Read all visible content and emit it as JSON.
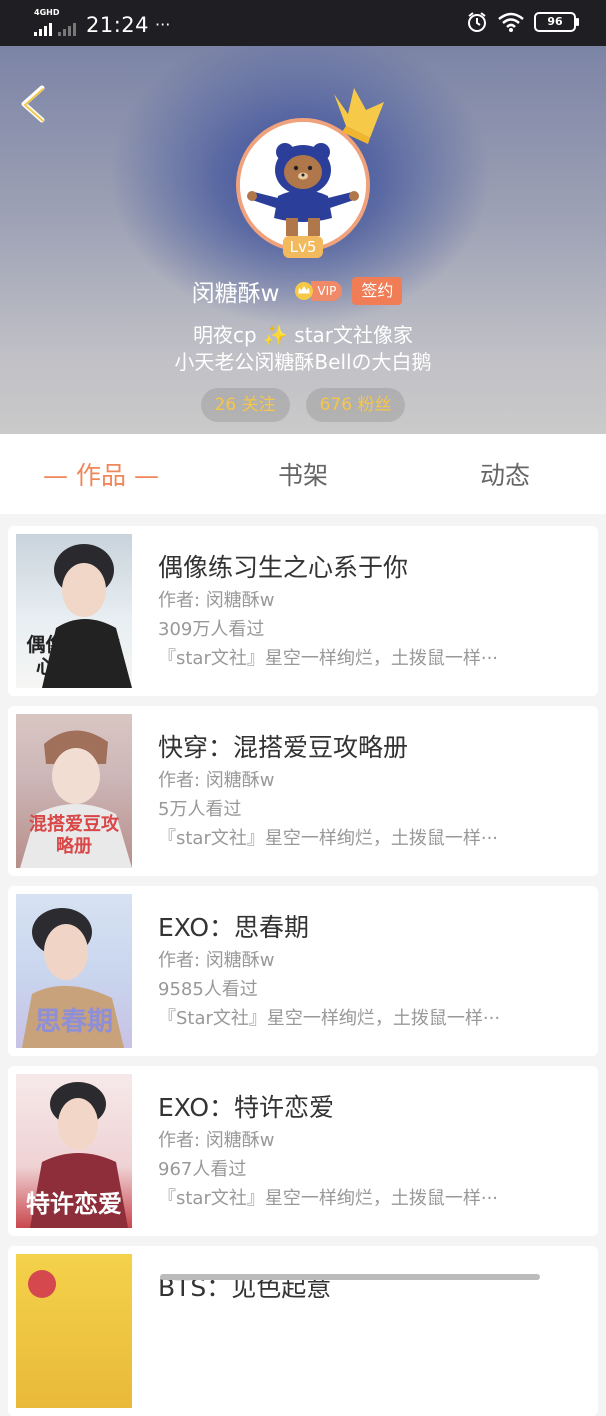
{
  "status_bar": {
    "network": "4GHD",
    "time": "21:24",
    "dots": "···",
    "battery": "96"
  },
  "profile": {
    "level": "Lv5",
    "username": "闵糖酥w",
    "vip_label": "VIP",
    "signed_label": "签约",
    "bio_line1": "明夜cp ✨ star文社像家",
    "bio_line2": "小天老公闵糖酥Bellの大白鹅",
    "following": "26 关注",
    "followers": "676 粉丝"
  },
  "tabs": [
    {
      "label": "— 作品 —",
      "active": true
    },
    {
      "label": "书架",
      "active": false
    },
    {
      "label": "动态",
      "active": false
    }
  ],
  "books": [
    {
      "title": "偶像练习生之心系于你",
      "author": "作者: 闵糖酥w",
      "views": "309万人看过",
      "desc": "『star文社』星空一样绚烂，土拨鼠一样···"
    },
    {
      "title": "快穿：混搭爱豆攻略册",
      "author": "作者: 闵糖酥w",
      "views": "5万人看过",
      "desc": "『star文社』星空一样绚烂，土拨鼠一样···"
    },
    {
      "title": "EXO：思春期",
      "author": "作者: 闵糖酥w",
      "views": "9585人看过",
      "desc": "『Star文社』星空一样绚烂，土拨鼠一样···"
    },
    {
      "title": "EXO：特许恋爱",
      "author": "作者: 闵糖酥w",
      "views": "967人看过",
      "desc": "『star文社』星空一样绚烂，土拨鼠一样···"
    },
    {
      "title": "BTS：见色起意"
    }
  ],
  "covers": [
    {
      "text": "偶像练习之心系于你"
    },
    {
      "text": "混搭爱豆攻略册"
    },
    {
      "text": "思春期"
    },
    {
      "text": "特许恋爱"
    }
  ],
  "colors": {
    "accent": "#f0875a",
    "stat_text": "#f7c548",
    "level_badge": "#f2b95d"
  }
}
